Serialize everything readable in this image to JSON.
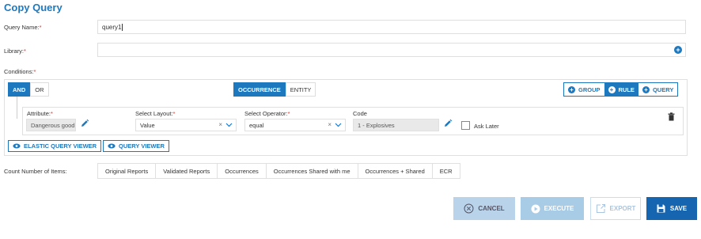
{
  "title": "Copy Query",
  "query_name": {
    "label": "Query Name:",
    "required": "*",
    "value": "query1"
  },
  "library": {
    "label": "Library:",
    "required": "*",
    "value": ""
  },
  "conditions": {
    "label": "Conditions:",
    "required": "*",
    "logic": [
      "AND",
      "OR"
    ],
    "scope": [
      "OCCURRENCE",
      "ENTITY"
    ],
    "add_buttons": {
      "group": "GROUP",
      "rule": "RULE",
      "query": "QUERY"
    }
  },
  "rule": {
    "attribute_label": "Attribute:",
    "attribute_value": "Dangerous good",
    "layout_label": "Select Layout:",
    "layout_value": "Value",
    "operator_label": "Select Operator:",
    "operator_value": "equal",
    "code_label": "Code",
    "code_value": "1 - Explosives",
    "ask_later": "Ask Later",
    "required": "*"
  },
  "viewers": {
    "elastic": "ELASTIC QUERY VIEWER",
    "query": "QUERY VIEWER"
  },
  "count": {
    "label": "Count Number of Items:",
    "tabs": [
      "Original Reports",
      "Validated Reports",
      "Occurrences",
      "Occurrences Shared with me",
      "Occurrences + Shared",
      "ECR"
    ]
  },
  "actions": {
    "cancel": "CANCEL",
    "execute": "EXECUTE",
    "export": "EXPORT",
    "save": "SAVE"
  },
  "icons": {
    "add": "plus-circle-icon",
    "edit": "pencil-icon",
    "delete": "trash-icon",
    "viewer": "eye-icon",
    "cancel": "x-circle-icon",
    "execute": "play-circle-icon",
    "export": "export-icon",
    "save": "floppy-disk-icon"
  },
  "colors": {
    "accent": "#1e78be",
    "cancel_bg": "#b9d4ea",
    "execute_bg": "#a8cbe6",
    "save_bg": "#1565b0"
  }
}
